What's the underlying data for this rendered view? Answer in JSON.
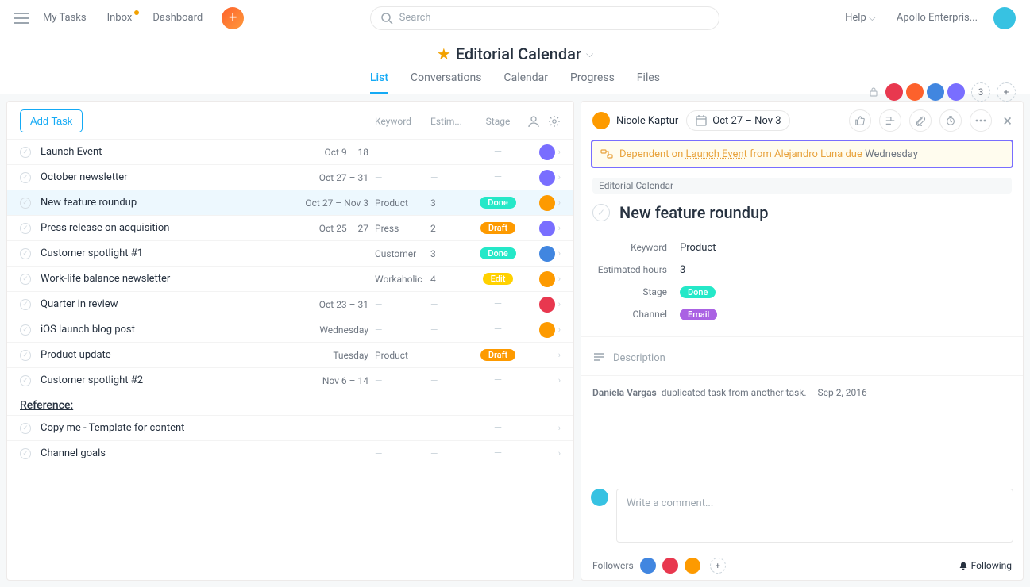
{
  "topnav": {
    "my_tasks": "My Tasks",
    "inbox": "Inbox",
    "dashboard": "Dashboard",
    "search_placeholder": "Search",
    "help": "Help",
    "org": "Apollo Enterpris..."
  },
  "project": {
    "title": "Editorial Calendar",
    "tabs": {
      "list": "List",
      "conversations": "Conversations",
      "calendar": "Calendar",
      "progress": "Progress",
      "files": "Files"
    },
    "member_overflow": "3"
  },
  "list": {
    "add_task": "Add Task",
    "cols": {
      "keyword": "Keyword",
      "estimated": "Estim...",
      "stage": "Stage"
    },
    "rows": [
      {
        "name": "Launch Event",
        "date": "Oct 9 – 18",
        "keyword": "",
        "est": "",
        "stage": "",
        "avatar_color": "#796eff"
      },
      {
        "name": "October newsletter",
        "date": "Oct 27 – 31",
        "keyword": "",
        "est": "",
        "stage": "",
        "avatar_color": "#796eff"
      },
      {
        "name": "New feature roundup",
        "date": "Oct 27 – Nov 3",
        "keyword": "Product",
        "est": "3",
        "stage": "Done",
        "avatar_color": "#fd9a00",
        "selected": true
      },
      {
        "name": "Press release on acquisition",
        "date": "Oct 25 – 27",
        "keyword": "Press",
        "est": "2",
        "stage": "Draft",
        "avatar_color": "#796eff"
      },
      {
        "name": "Customer spotlight #1",
        "date": "",
        "keyword": "Customer",
        "est": "3",
        "stage": "Done",
        "avatar_color": "#4186e0"
      },
      {
        "name": "Work-life balance newsletter",
        "date": "",
        "keyword": "Workaholic",
        "est": "4",
        "stage": "Edit",
        "avatar_color": "#fd9a00"
      },
      {
        "name": "Quarter in review",
        "date": "Oct 23 – 31",
        "keyword": "",
        "est": "",
        "stage": "",
        "avatar_color": "#e8384f"
      },
      {
        "name": "iOS launch blog post",
        "date": "Wednesday",
        "keyword": "",
        "est": "",
        "stage": "",
        "avatar_color": "#fd9a00"
      },
      {
        "name": "Product update",
        "date": "Tuesday",
        "keyword": "Product",
        "est": "",
        "stage": "Draft",
        "avatar_color": ""
      },
      {
        "name": "Customer spotlight #2",
        "date": "Nov 6 – 14",
        "keyword": "",
        "est": "",
        "stage": "",
        "avatar_color": ""
      }
    ],
    "section": "Reference:",
    "ref_rows": [
      {
        "name": "Copy me - Template for content",
        "date": "",
        "keyword": "",
        "est": "",
        "stage": "",
        "avatar_color": ""
      },
      {
        "name": "Channel goals",
        "date": "",
        "keyword": "",
        "est": "",
        "stage": "",
        "avatar_color": ""
      }
    ]
  },
  "detail": {
    "assignee": "Nicole Kaptur",
    "date": "Oct 27 – Nov 3",
    "dependency": {
      "prefix": "Dependent on",
      "link": "Launch Event",
      "mid": "from Alejandro Luna due",
      "when": "Wednesday"
    },
    "project_tag": "Editorial Calendar",
    "title": "New feature roundup",
    "fields": {
      "keyword_label": "Keyword",
      "keyword_val": "Product",
      "est_label": "Estimated hours",
      "est_val": "3",
      "stage_label": "Stage",
      "stage_val": "Done",
      "channel_label": "Channel",
      "channel_val": "Email"
    },
    "description_placeholder": "Description",
    "activity": {
      "who": "Daniela Vargas",
      "what": "duplicated task from another task.",
      "when": "Sep 2, 2016"
    },
    "comment_placeholder": "Write a comment...",
    "followers_label": "Followers",
    "following": "Following"
  },
  "avatars": {
    "topright": "#37c2e2",
    "members": [
      "#e8384f",
      "#fd612c",
      "#4186e0",
      "#796eff"
    ],
    "detail_assignee": "#fd9a00",
    "comment": "#37c2e2",
    "followers": [
      "#4186e0",
      "#e8384f",
      "#fd9a00"
    ]
  }
}
